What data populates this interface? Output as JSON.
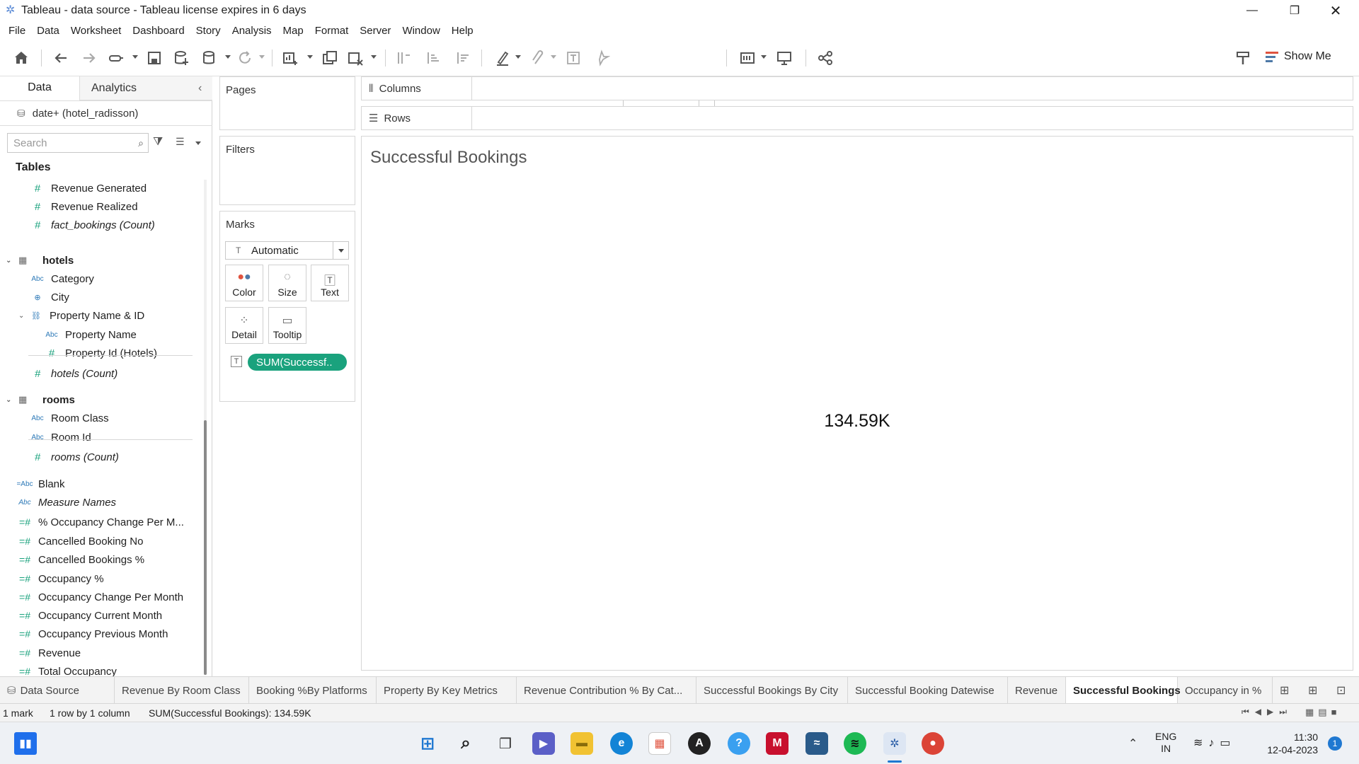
{
  "window": {
    "title": "Tableau - data source - Tableau license expires in 6 days"
  },
  "menu": [
    "File",
    "Data",
    "Worksheet",
    "Dashboard",
    "Story",
    "Analysis",
    "Map",
    "Format",
    "Server",
    "Window",
    "Help"
  ],
  "toolbar": {
    "fit": "Entire View",
    "show_me": "Show Me"
  },
  "left_pane": {
    "tabs": {
      "data": "Data",
      "analytics": "Analytics"
    },
    "datasource": "date+ (hotel_radisson)",
    "search_placeholder": "Search",
    "tables_header": "Tables",
    "fields_top": [
      "Revenue Generated",
      "Revenue Realized",
      "fact_bookings (Count)"
    ],
    "hotels": {
      "name": "hotels",
      "category": "Category",
      "city": "City",
      "hierarchy": "Property Name & ID",
      "property_name": "Property Name",
      "property_id": "Property Id (Hotels)",
      "count": "hotels (Count)"
    },
    "rooms": {
      "name": "rooms",
      "room_class": "Room Class",
      "room_id": "Room Id",
      "count": "rooms (Count)"
    },
    "blank": "Blank",
    "measure_names": "Measure Names",
    "calcs": [
      "% Occupancy Change Per M...",
      "Cancelled Booking No",
      "Cancelled Bookings %",
      "Occupancy %",
      "Occupancy Change Per Month",
      "Occupancy Current Month",
      "Occupancy Previous Month",
      "Revenue",
      "Total Occupancy"
    ]
  },
  "cards": {
    "pages": "Pages",
    "filters": "Filters",
    "marks": "Marks",
    "mark_type": "Automatic",
    "buttons": {
      "color": "Color",
      "size": "Size",
      "text": "Text",
      "detail": "Detail",
      "tooltip": "Tooltip"
    },
    "pill": "SUM(Successf.."
  },
  "shelves": {
    "columns": "Columns",
    "rows": "Rows"
  },
  "viz": {
    "title": "Successful Bookings",
    "value": "134.59K"
  },
  "sheet_tabs": [
    "Data Source",
    "Revenue By Room Class",
    "Booking %By Platforms",
    "Property By Key Metrics",
    "Revenue Contribution % By Cat...",
    "Successful Bookings By City",
    "Successful Booking Datewise",
    "Revenue",
    "Successful Bookings",
    "Occupancy in %"
  ],
  "status": {
    "marks": "1 mark",
    "rows_cols": "1 row by 1 column",
    "sum": "SUM(Successful Bookings): 134.59K"
  },
  "taskbar": {
    "lang": "ENG",
    "region": "IN",
    "time": "11:30",
    "date": "12-04-2023",
    "badge": "1"
  }
}
